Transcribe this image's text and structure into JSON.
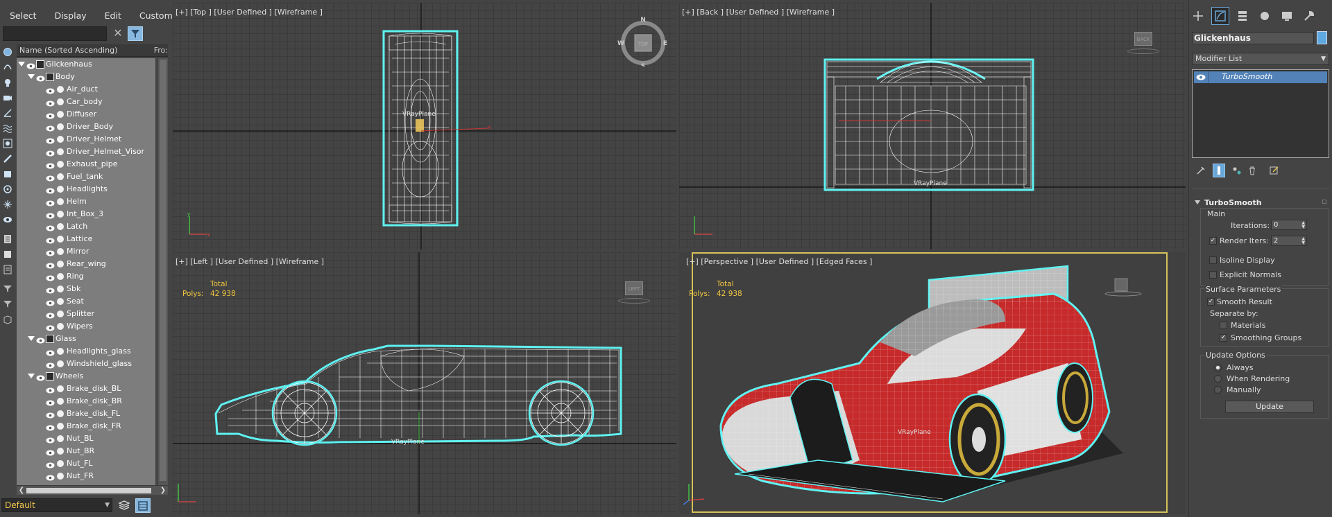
{
  "menu": [
    "Select",
    "Display",
    "Edit",
    "Customize"
  ],
  "explorer": {
    "search_placeholder": "",
    "column_name": "Name (Sorted Ascending)",
    "column_frozen": "Fro:",
    "layer": "Default",
    "tree": [
      {
        "label": "Glickenhaus",
        "level": 0,
        "type": "group"
      },
      {
        "label": "Body",
        "level": 1,
        "type": "group"
      },
      {
        "label": "Air_duct",
        "level": 2,
        "type": "object"
      },
      {
        "label": "Car_body",
        "level": 2,
        "type": "object"
      },
      {
        "label": "Diffuser",
        "level": 2,
        "type": "object"
      },
      {
        "label": "Driver_Body",
        "level": 2,
        "type": "object"
      },
      {
        "label": "Driver_Helmet",
        "level": 2,
        "type": "object"
      },
      {
        "label": "Driver_Helmet_Visor",
        "level": 2,
        "type": "object"
      },
      {
        "label": "Exhaust_pipe",
        "level": 2,
        "type": "object"
      },
      {
        "label": "Fuel_tank",
        "level": 2,
        "type": "object"
      },
      {
        "label": "Headlights",
        "level": 2,
        "type": "object"
      },
      {
        "label": "Helm",
        "level": 2,
        "type": "object"
      },
      {
        "label": "Int_Box_3",
        "level": 2,
        "type": "object"
      },
      {
        "label": "Latch",
        "level": 2,
        "type": "object"
      },
      {
        "label": "Lattice",
        "level": 2,
        "type": "object"
      },
      {
        "label": "Mirror",
        "level": 2,
        "type": "object"
      },
      {
        "label": "Rear_wing",
        "level": 2,
        "type": "object"
      },
      {
        "label": "Ring",
        "level": 2,
        "type": "object"
      },
      {
        "label": "Sbk",
        "level": 2,
        "type": "object"
      },
      {
        "label": "Seat",
        "level": 2,
        "type": "object"
      },
      {
        "label": "Splitter",
        "level": 2,
        "type": "object"
      },
      {
        "label": "Wipers",
        "level": 2,
        "type": "object"
      },
      {
        "label": "Glass",
        "level": 1,
        "type": "group"
      },
      {
        "label": "Headlights_glass",
        "level": 2,
        "type": "object"
      },
      {
        "label": "Windshield_glass",
        "level": 2,
        "type": "object"
      },
      {
        "label": "Wheels",
        "level": 1,
        "type": "group"
      },
      {
        "label": "Brake_disk_BL",
        "level": 2,
        "type": "object"
      },
      {
        "label": "Brake_disk_BR",
        "level": 2,
        "type": "object"
      },
      {
        "label": "Brake_disk_FL",
        "level": 2,
        "type": "object"
      },
      {
        "label": "Brake_disk_FR",
        "level": 2,
        "type": "object"
      },
      {
        "label": "Nut_BL",
        "level": 2,
        "type": "object"
      },
      {
        "label": "Nut_BR",
        "level": 2,
        "type": "object"
      },
      {
        "label": "Nut_FL",
        "level": 2,
        "type": "object"
      },
      {
        "label": "Nut_FR",
        "level": 2,
        "type": "object"
      }
    ]
  },
  "viewports": {
    "top": {
      "label": "[+] [Top ] [User Defined ] [Wireframe ]",
      "object_label": "VRayPlane",
      "cube": "TOP",
      "compass": {
        "n": "N",
        "s": "S",
        "e": "E",
        "w": "W"
      }
    },
    "back": {
      "label": "[+] [Back ] [User Defined ] [Wireframe ]",
      "object_label": "VRayPlane",
      "cube": "BACK"
    },
    "left": {
      "label": "[+] [Left ] [User Defined ] [Wireframe ]",
      "object_label": "VRayPlane",
      "cube": "LEFT",
      "stats_total": "Total",
      "stats_polys_label": "Polys:",
      "stats_polys_value": "42 938"
    },
    "persp": {
      "label": "[+] [Perspective ] [User Defined ] [Edged Faces ]",
      "object_label": "VRayPlane",
      "stats_total": "Total",
      "stats_polys_label": "Polys:",
      "stats_polys_value": "42 938"
    }
  },
  "command_panel": {
    "object_name": "Glickenhaus",
    "object_color": "#5fa8e0",
    "modifier_list": "Modifier List",
    "stack_item": "TurboSmooth",
    "rollout": {
      "title": "TurboSmooth",
      "main_label": "Main",
      "iterations_label": "Iterations:",
      "iterations_value": "0",
      "render_iters_label": "Render Iters:",
      "render_iters_value": "2",
      "render_iters_checked": true,
      "isoline_label": "Isoline Display",
      "isoline_checked": false,
      "explicit_normals_label": "Explicit Normals",
      "explicit_normals_checked": false,
      "surface_params_label": "Surface Parameters",
      "smooth_result_label": "Smooth Result",
      "smooth_result_checked": true,
      "separate_by_label": "Separate by:",
      "materials_label": "Materials",
      "materials_checked": false,
      "smoothing_groups_label": "Smoothing Groups",
      "smoothing_groups_checked": true,
      "update_options_label": "Update Options",
      "always_label": "Always",
      "when_rendering_label": "When Rendering",
      "manually_label": "Manually",
      "update_option_selected": "Always",
      "update_button": "Update"
    }
  },
  "colors": {
    "selection_cyan": "#5ff2f2",
    "active_viewport_border": "#d6c25a",
    "stats_yellow": "#f0c640",
    "car_red": "#c42222",
    "accent_blue": "#6aa7d9"
  }
}
